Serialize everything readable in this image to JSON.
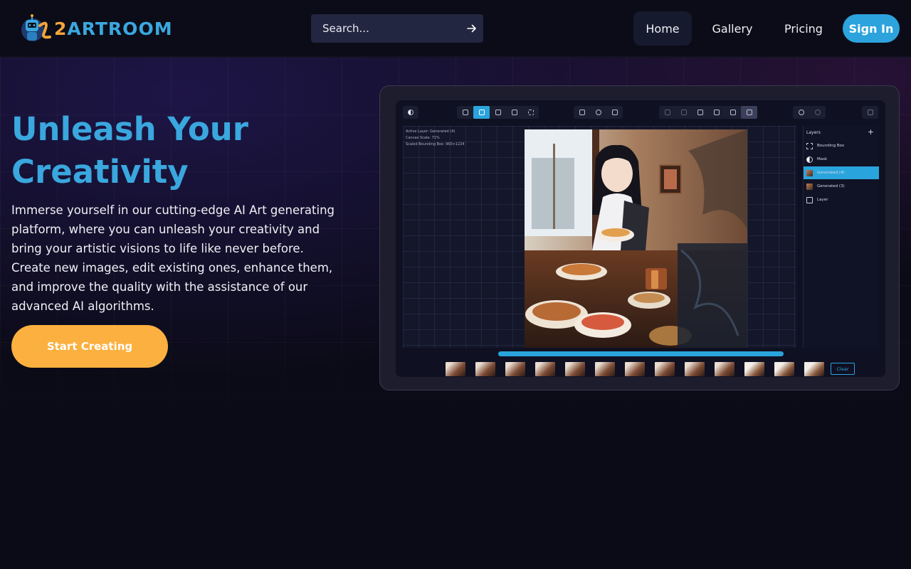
{
  "brand": {
    "logo_text_part1": "2",
    "logo_text_part2": "ARTROOM",
    "accent_blue": "#3aa7de",
    "accent_orange": "#fbb03f"
  },
  "search": {
    "placeholder": "Search...",
    "submit_icon": "arrow-right-icon"
  },
  "nav": {
    "items": [
      {
        "label": "Home",
        "active": true
      },
      {
        "label": "Gallery",
        "active": false
      },
      {
        "label": "Pricing",
        "active": false
      }
    ],
    "signin_label": "Sign In"
  },
  "hero": {
    "title_line1": "Unleash Your",
    "title_line2": "Creativity",
    "description": "Immerse yourself in our cutting-edge AI Art generating platform, where you can unleash your creativity and bring your artistic visions to life like never before. Create new images, edit existing ones, enhance them, and improve the quality with the assistance of our advanced AI algorithms.",
    "cta_label": "Start Creating"
  },
  "editor_preview": {
    "info_lines": [
      "Active Layer: Generated (4)",
      "Canvas Scale: 71%",
      "Scaled Bounding Box: 960×1224"
    ],
    "layers_title": "Layers",
    "layers": [
      {
        "label": "Bounding Box",
        "icon": "bounding-box-icon",
        "active": false
      },
      {
        "label": "Mask",
        "icon": "mask-icon",
        "active": false
      },
      {
        "label": "Generated (4)",
        "icon": "image-thumb",
        "active": true
      },
      {
        "label": "Generated (3)",
        "icon": "image-thumb",
        "active": false
      },
      {
        "label": "Layer",
        "icon": "image-icon",
        "active": false
      }
    ],
    "clear_label": "Clear",
    "progress": 1.0
  }
}
